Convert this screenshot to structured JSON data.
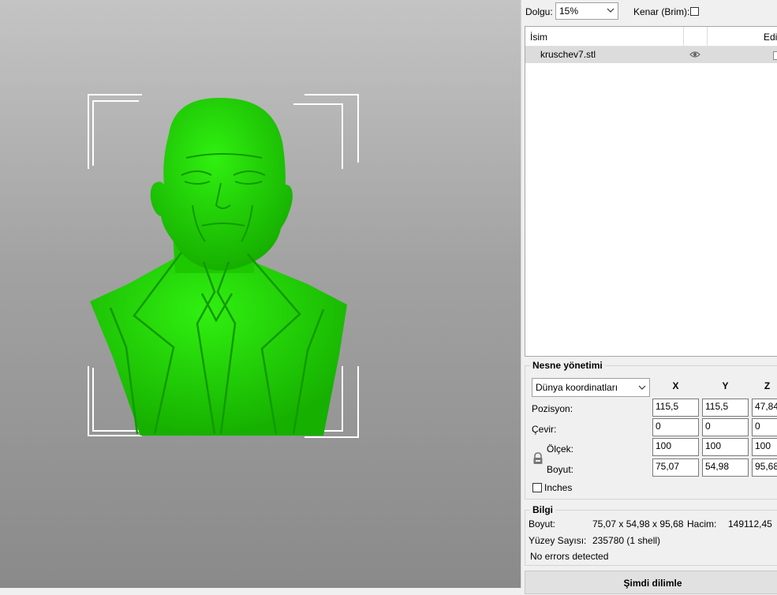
{
  "toolbar": {
    "infill_label": "Dolgu:",
    "infill_value": "15%",
    "brim_label": "Kenar (Brim):"
  },
  "object_list": {
    "columns": [
      "İsim",
      "Edi"
    ],
    "rows": [
      {
        "name": "kruschev7.stl",
        "visible_icon": "eye-icon"
      }
    ]
  },
  "object_manipulation": {
    "title": "Nesne yönetimi",
    "coord_system": "Dünya koordinatları",
    "axes": [
      "X",
      "Y",
      "Z"
    ],
    "position_label": "Pozisyon:",
    "position": [
      "115,5",
      "115,5",
      "47,84"
    ],
    "rotate_label": "Çevir:",
    "rotate": [
      "0",
      "0",
      "0"
    ],
    "scale_label": "Ölçek:",
    "scale": [
      "100",
      "100",
      "100"
    ],
    "size_label": "Boyut:",
    "size": [
      "75,07",
      "54,98",
      "95,68"
    ],
    "inches_label": "Inches",
    "lock_icon": "lock-icon"
  },
  "info": {
    "title": "Bilgi",
    "size_label": "Boyut:",
    "size_value": "75,07 x 54,98 x 95,68",
    "volume_label": "Hacim:",
    "volume_value": "149112,45",
    "facets_label": "Yüzey Sayısı:",
    "facets_value": "235780 (1 shell)",
    "errors": "No errors detected"
  },
  "slice_button": "Şimdi dilimle",
  "colors": {
    "model": "#22dd00",
    "model_dark": "#17a800",
    "bracket": "#ffffff"
  }
}
